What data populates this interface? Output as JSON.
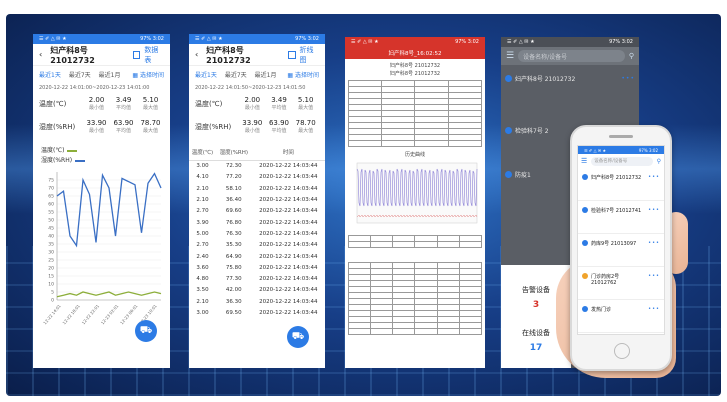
{
  "phone1": {
    "status_left": "☰ ✐ △ ✉ ★",
    "status_right": "97% 3:02",
    "title": "妇产科8号 21012732",
    "mode_label": "数据表",
    "tabs": [
      "最近1天",
      "最近7天",
      "最近1月"
    ],
    "custom_label": "选择时间",
    "range": "2020-12-22 14:01:00~2020-12-23 14:01:00",
    "temp_label": "温度(℃)",
    "hum_label": "湿度(%RH)",
    "temp_vals": [
      "2.00",
      "3.49",
      "5.10"
    ],
    "hum_vals": [
      "33.90",
      "63.90",
      "78.70"
    ],
    "stat_names": [
      "最小值",
      "平均值",
      "最大值"
    ],
    "legend_temp": "温度(℃)",
    "legend_hum": "湿度(%RH)"
  },
  "chart_data": {
    "type": "line",
    "ylim": [
      0,
      80
    ],
    "yticks": [
      "0",
      "5",
      "10",
      "15",
      "20",
      "25",
      "30",
      "35",
      "40",
      "45",
      "50",
      "55",
      "60",
      "65",
      "70",
      "75"
    ],
    "xticks": [
      "12-22 14:01",
      "12-22 18:01",
      "12-22 22:01",
      "12-23 02:01",
      "12-23 06:01",
      "12-23 10:01"
    ],
    "series": [
      {
        "name": "湿度(%RH)",
        "color": "#3a6fc4",
        "values": [
          65,
          68,
          40,
          34,
          75,
          66,
          36,
          78,
          70,
          40,
          76,
          74,
          72,
          42,
          73,
          79,
          70
        ]
      },
      {
        "name": "温度(℃)",
        "color": "#8cae3a",
        "values": [
          2,
          3,
          4,
          3,
          5,
          4,
          3,
          4,
          5,
          3,
          4,
          5,
          4,
          3,
          4,
          5,
          4
        ]
      }
    ]
  },
  "phone2": {
    "title": "妇产科8号 21012732",
    "mode_label": "折线图",
    "tabs": [
      "最近1天",
      "最近7天",
      "最近1月"
    ],
    "custom_label": "选择时间",
    "range": "2020-12-22 14:01:50~2020-12-23 14:01:50",
    "temp_vals": [
      "2.00",
      "3.49",
      "5.10"
    ],
    "hum_vals": [
      "33.90",
      "63.90",
      "78.70"
    ],
    "headers": [
      "温度(℃)",
      "湿度(%RH)",
      "时间"
    ],
    "rows": [
      [
        "3.00",
        "72.30",
        "2020-12-22 14:03:44"
      ],
      [
        "4.10",
        "77.20",
        "2020-12-22 14:03:44"
      ],
      [
        "2.10",
        "58.10",
        "2020-12-22 14:03:44"
      ],
      [
        "2.10",
        "36.40",
        "2020-12-22 14:03:44"
      ],
      [
        "2.70",
        "69.60",
        "2020-12-22 14:03:44"
      ],
      [
        "3.90",
        "76.80",
        "2020-12-22 14:03:44"
      ],
      [
        "5.00",
        "76.30",
        "2020-12-22 14:03:44"
      ],
      [
        "2.70",
        "35.30",
        "2020-12-22 14:03:44"
      ],
      [
        "2.40",
        "64.90",
        "2020-12-22 14:03:44"
      ],
      [
        "3.60",
        "75.80",
        "2020-12-22 14:03:44"
      ],
      [
        "4.80",
        "77.30",
        "2020-12-22 14:03:44"
      ],
      [
        "3.50",
        "42.00",
        "2020-12-22 14:03:44"
      ],
      [
        "2.10",
        "36.30",
        "2020-12-22 14:03:44"
      ],
      [
        "3.00",
        "69.50",
        "2020-12-22 14:03:44"
      ]
    ]
  },
  "phone3": {
    "title": "妇产科8号_16:02:52",
    "doc_title_1": "妇产科8号 21012732",
    "doc_title_2": "妇产科8号 21012732",
    "chart_title": "历史曲线"
  },
  "phone4": {
    "search_placeholder": "设备名称/设备号",
    "devices": [
      "妇产科8号 21012732",
      "检验科7号 2",
      "防疫1"
    ],
    "alarm_label": "告警设备",
    "alarm_count": "3",
    "online_label": "在线设备",
    "online_count": "17"
  },
  "phone5": {
    "search_placeholder": "设备名称/设备号",
    "devices": [
      "妇产科8号 21012732",
      "检验科7号 21012741",
      "药库9号 21013097",
      "门诊药房2号 21012762",
      "发热门诊"
    ]
  }
}
